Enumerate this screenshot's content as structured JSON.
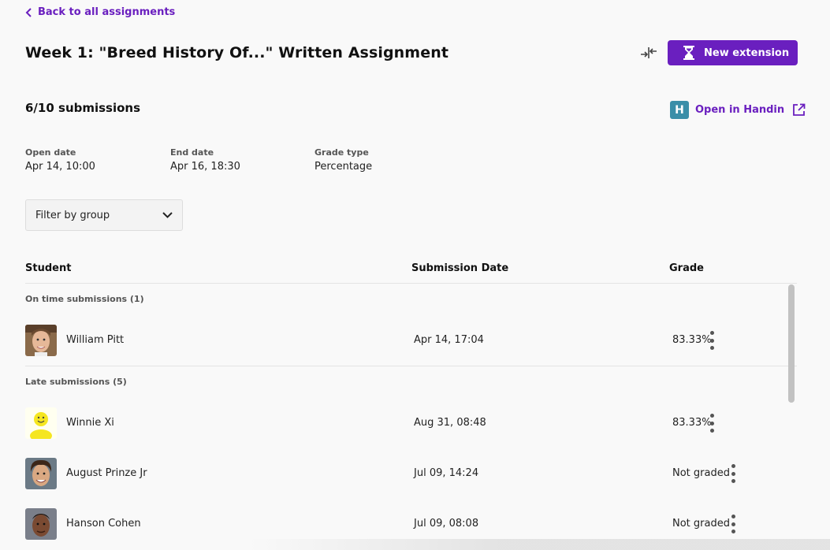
{
  "nav": {
    "back_label": "Back to all assignments"
  },
  "header": {
    "title": "Week 1: \"Breed History Of...\" Written Assignment",
    "extension_button": "New extension"
  },
  "summary": {
    "submissions": "6/10 submissions",
    "handin_logo_letter": "H",
    "handin_link": "Open in Handin"
  },
  "meta": [
    {
      "label": "Open date",
      "value": "Apr 14, 10:00"
    },
    {
      "label": "End date",
      "value": "Apr 16, 18:30"
    },
    {
      "label": "Grade type",
      "value": "Percentage"
    }
  ],
  "filter": {
    "label": "Filter by group"
  },
  "table": {
    "columns": {
      "student": "Student",
      "date": "Submission Date",
      "grade": "Grade"
    },
    "sections": [
      {
        "title": "On time submissions (1)",
        "rows": [
          {
            "name": "William Pitt",
            "date": "Apr 14, 17:04",
            "grade": "83.33%"
          }
        ]
      },
      {
        "title": "Late submissions (5)",
        "rows": [
          {
            "name": "Winnie Xi",
            "date": "Aug 31, 08:48",
            "grade": "83.33%"
          },
          {
            "name": "August Prinze Jr",
            "date": "Jul 09, 14:24",
            "grade": "Not graded"
          },
          {
            "name": "Hanson Cohen",
            "date": "Jul 09, 08:08",
            "grade": "Not graded"
          }
        ]
      }
    ]
  },
  "colors": {
    "accent": "#6a1fbf",
    "handin": "#3a8ea8"
  }
}
